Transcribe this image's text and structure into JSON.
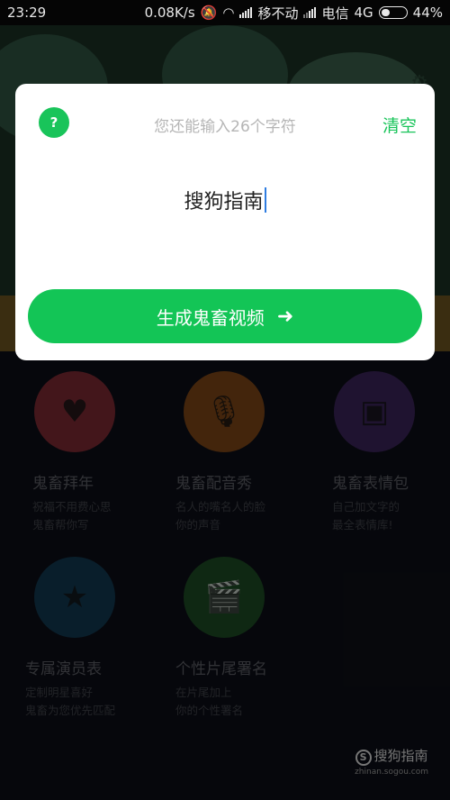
{
  "status_bar": {
    "time": "23:29",
    "speed": "0.08K/s",
    "carrier1": "移不动",
    "carrier2": "电信",
    "network": "4G",
    "battery": "44%"
  },
  "dialog": {
    "hint": "您还能输入26个字符",
    "clear_label": "清空",
    "input_value": "搜狗指南",
    "generate_label": "生成鬼畜视频",
    "help_icon": "?",
    "colors": {
      "accent": "#13c556"
    }
  },
  "menu": {
    "items": [
      {
        "title": "鬼畜拜年",
        "desc1": "祝福不用费心思",
        "desc2": "鬼畜帮你写",
        "icon": "heart-icon",
        "color": "#7a2832"
      },
      {
        "title": "鬼畜配音秀",
        "desc1": "名人的嘴名人的脸",
        "desc2": "你的声音",
        "icon": "microphone-icon",
        "color": "#7a4416"
      },
      {
        "title": "鬼畜表情包",
        "desc1": "自己加文字的",
        "desc2": "最全表情库!",
        "icon": "emoji-pack-icon",
        "color": "#3a2458"
      },
      {
        "title": "专属演员表",
        "desc1": "定制明星喜好",
        "desc2": "鬼畜为您优先匹配",
        "icon": "star-icon",
        "color": "#12384f"
      },
      {
        "title": "个性片尾署名",
        "desc1": "在片尾加上",
        "desc2": "你的个性署名",
        "icon": "clapperboard-icon",
        "color": "#1d4a24"
      }
    ]
  },
  "watermark": {
    "brand": "搜狗指南",
    "url": "zhinan.sogou.com"
  }
}
